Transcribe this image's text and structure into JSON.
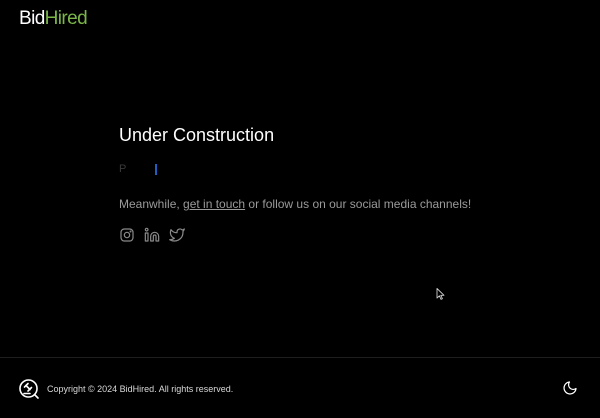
{
  "header": {
    "logo_part1": "Bid",
    "logo_part2": "Hired"
  },
  "main": {
    "title": "Under Construction",
    "typing_text": "P",
    "message_before": "Meanwhile, ",
    "message_link": "get in touch",
    "message_after": " or follow us on our social media channels!",
    "socials": [
      {
        "icon": "instagram-icon"
      },
      {
        "icon": "linkedin-icon"
      },
      {
        "icon": "twitter-icon"
      }
    ]
  },
  "footer": {
    "copyright": "Copyright © 2024 BidHired. All rights reserved.",
    "theme_icon": "moon-icon"
  },
  "colors": {
    "background": "#000000",
    "brand_green": "#7ab648",
    "text_muted": "#9a9a9a",
    "cursor_blue": "#1f5fbf"
  }
}
